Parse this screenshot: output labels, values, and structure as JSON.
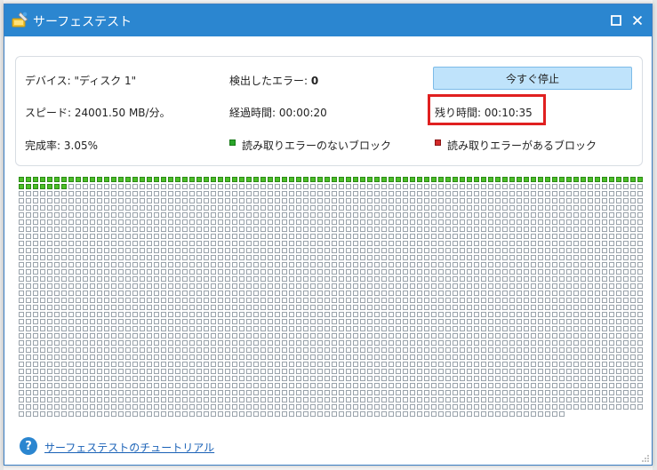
{
  "window": {
    "title": "サーフェステスト"
  },
  "info": {
    "device_label": "デバイス:",
    "device_value": "\"ディスク 1\"",
    "errors_label": "検出したエラー:",
    "errors_value": "0",
    "speed_label": "スピード:",
    "speed_value": "24001.50 MB/分。",
    "elapsed_label": "経過時間:",
    "elapsed_value": "00:00:20",
    "remaining_label": "残り時間:",
    "remaining_value": "00:10:35",
    "completion_label": "完成率:",
    "completion_value": "3.05%",
    "legend_ok": "読み取りエラーのないブロック",
    "legend_error": "読み取りエラーがあるブロック"
  },
  "toolbar": {
    "stop_label": "今すぐ停止"
  },
  "progress": {
    "completion_fraction": 0.0305,
    "blocks_per_row": 88,
    "rows": 34,
    "last_row_count": 77,
    "completed_blocks": 95
  },
  "footer": {
    "help_icon": "?",
    "tutorial_link": "サーフェステストのチュートリアル"
  },
  "colors": {
    "titlebar": "#2b86d0",
    "block_ok": "#4cbf26",
    "block_error": "#d42a2a",
    "highlight": "#e02020",
    "stop_button": "#bfe3fb"
  }
}
